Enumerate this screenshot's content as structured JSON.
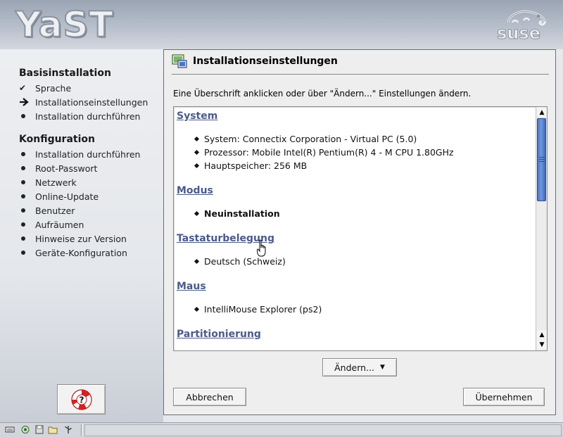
{
  "header": {
    "app_logo_text": "YaST",
    "vendor_logo_text": "suse"
  },
  "steps": {
    "section1_title": "Basisinstallation",
    "section1_items": [
      {
        "label": "Sprache",
        "state": "done"
      },
      {
        "label": "Installationseinstellungen",
        "state": "current"
      },
      {
        "label": "Installation durchführen",
        "state": "pending"
      }
    ],
    "section2_title": "Konfiguration",
    "section2_items": [
      {
        "label": "Installation durchführen"
      },
      {
        "label": "Root-Passwort"
      },
      {
        "label": "Netzwerk"
      },
      {
        "label": "Online-Update"
      },
      {
        "label": "Benutzer"
      },
      {
        "label": "Aufräumen"
      },
      {
        "label": "Hinweise zur Version"
      },
      {
        "label": "Geräte-Konfiguration"
      }
    ]
  },
  "dialog": {
    "title": "Installationseinstellungen",
    "hint": "Eine Überschrift anklicken oder über \"Ändern...\" Einstellungen ändern.",
    "sections": {
      "system": {
        "heading": "System",
        "items": [
          "System: Connectix Corporation - Virtual PC (5.0)",
          "Prozessor: Mobile Intel(R) Pentium(R) 4 - M CPU 1.80GHz",
          "Hauptspeicher: 256 MB"
        ]
      },
      "modus": {
        "heading": "Modus",
        "items": [
          "Neuinstallation"
        ]
      },
      "tastatur": {
        "heading": "Tastaturbelegung",
        "items": [
          "Deutsch (Schweiz)"
        ]
      },
      "maus": {
        "heading": "Maus",
        "items": [
          "IntelliMouse Explorer (ps2)"
        ]
      },
      "partitionierung": {
        "heading": "Partitionierung"
      }
    },
    "aendern_button": "Ändern...",
    "cancel_button": "Abbrechen",
    "accept_button": "Übernehmen"
  },
  "colors": {
    "link_heading": "#4a5b8a",
    "scroll_thumb": "#4a74c3",
    "header_bg": "#9aa4b3"
  }
}
